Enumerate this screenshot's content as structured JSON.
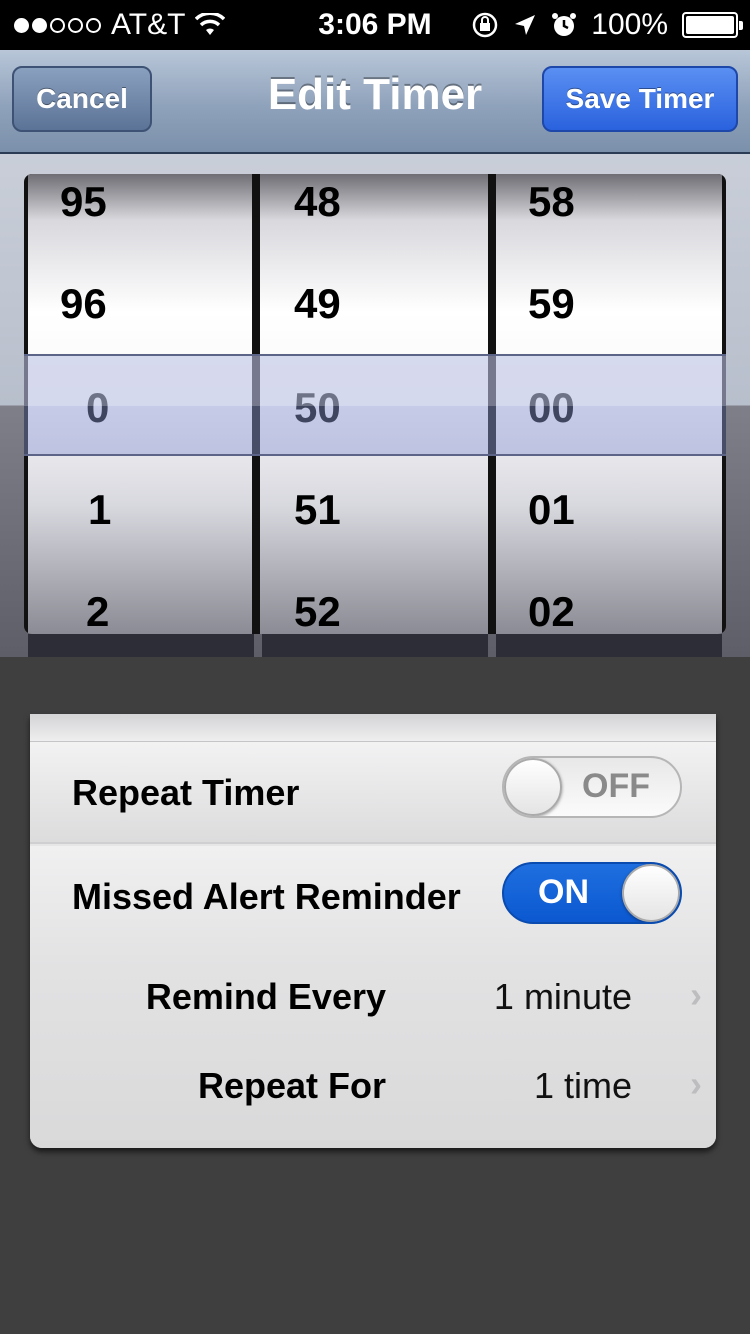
{
  "status_bar": {
    "carrier": "AT&T",
    "time": "3:06 PM",
    "battery": "100%"
  },
  "nav": {
    "title": "Edit Timer",
    "cancel_label": "Cancel",
    "save_label": "Save Timer"
  },
  "picker": {
    "hours": [
      "95",
      "96",
      "0",
      "1",
      "2"
    ],
    "minutes": [
      "48",
      "49",
      "50",
      "51",
      "52"
    ],
    "seconds": [
      "58",
      "59",
      "00",
      "01",
      "02"
    ],
    "selected": {
      "hours": "0",
      "minutes": "50",
      "seconds": "00"
    }
  },
  "settings": {
    "repeat_timer": {
      "label": "Repeat Timer",
      "state": "OFF"
    },
    "missed_alert": {
      "label": "Missed Alert Reminder",
      "state": "ON"
    },
    "remind_every": {
      "label": "Remind Every",
      "value": "1 minute"
    },
    "repeat_for": {
      "label": "Repeat For",
      "value": "1 time"
    }
  },
  "colors": {
    "toggle_on": "#0b58d0",
    "save_button": "#2a62de",
    "background": "#3f3f3f"
  }
}
